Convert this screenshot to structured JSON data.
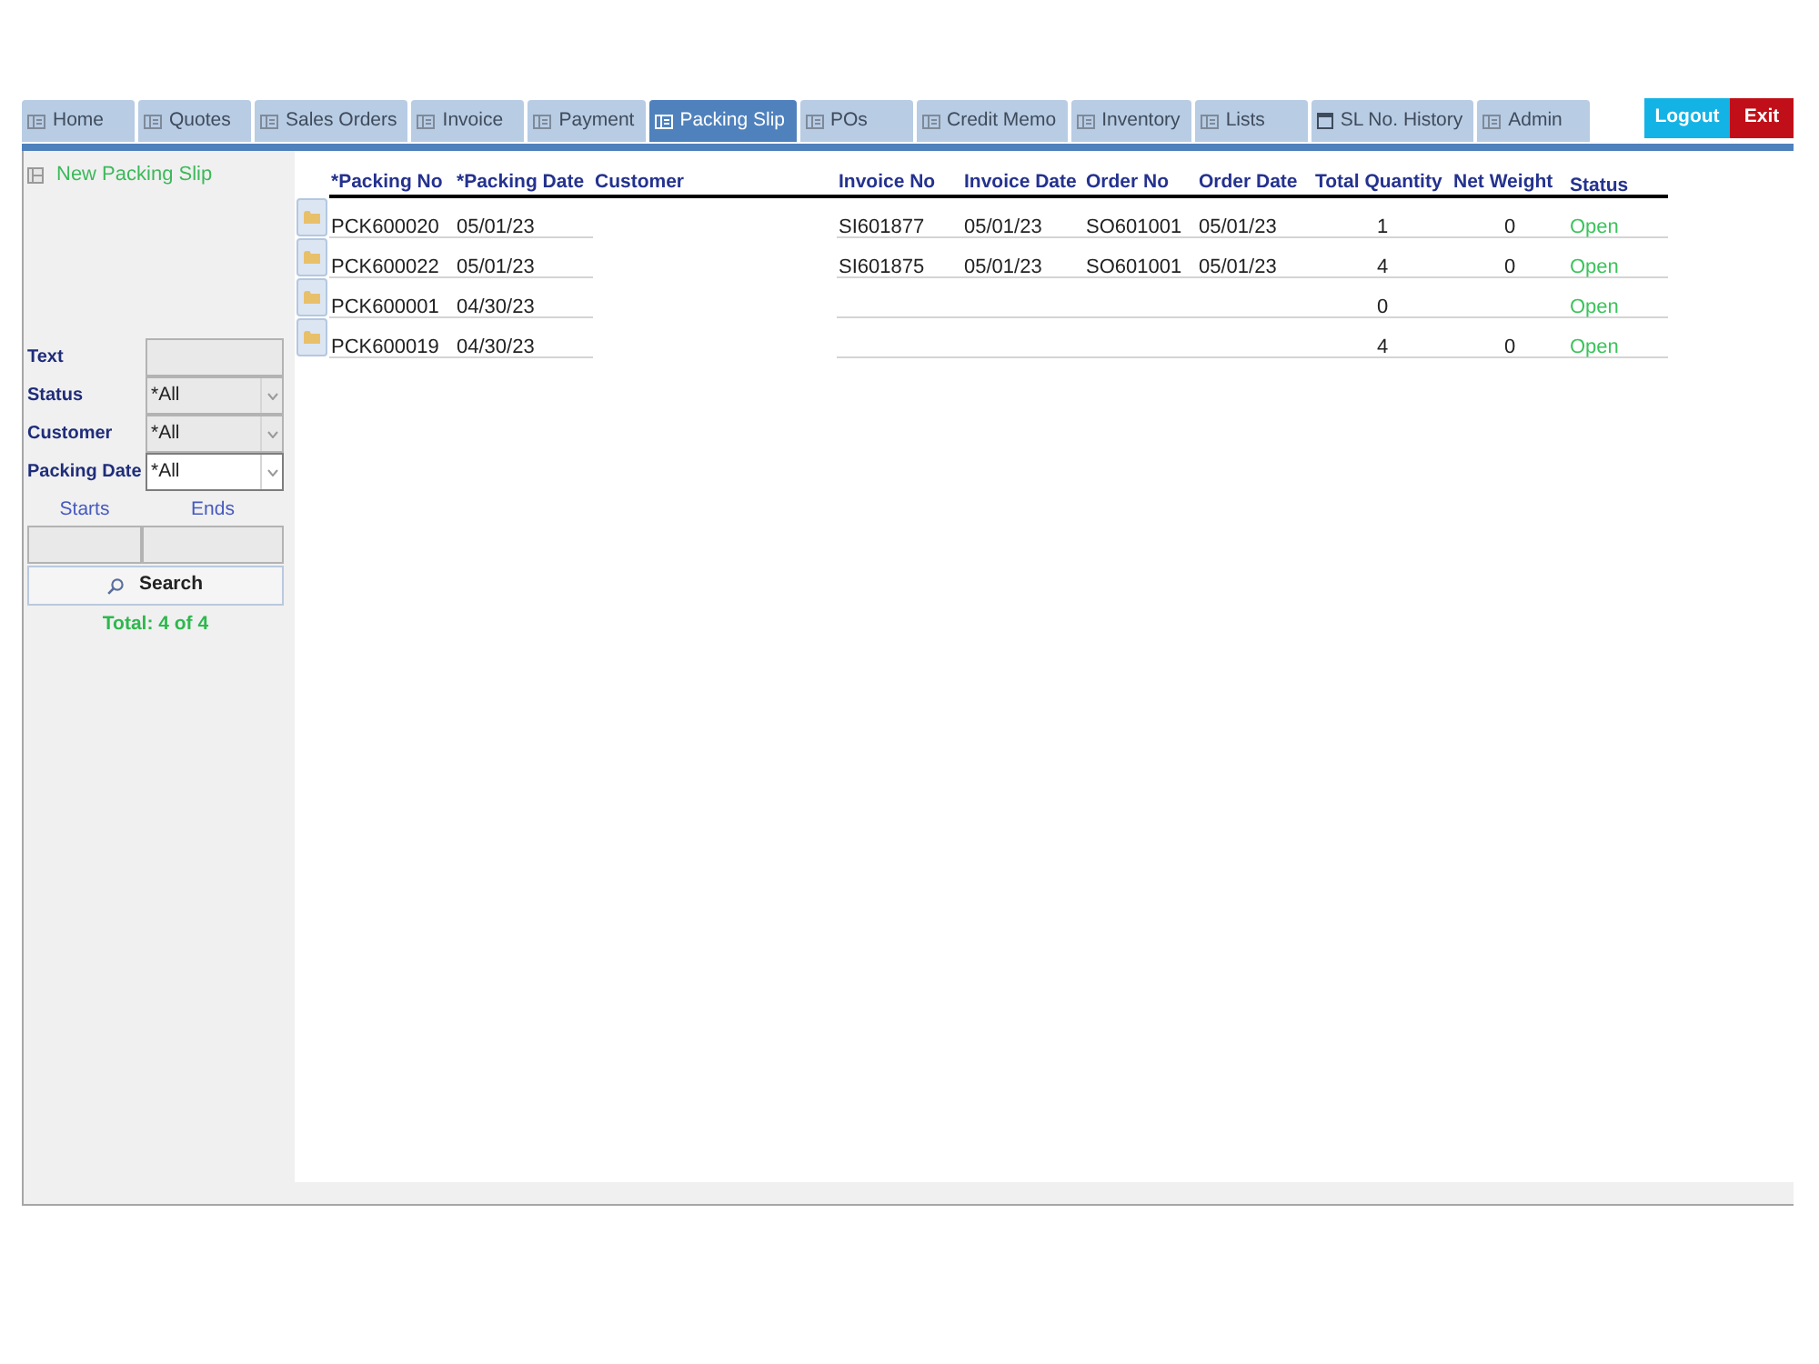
{
  "tabs": [
    {
      "label": "Home",
      "kind": "form",
      "selected": false
    },
    {
      "label": "Quotes",
      "kind": "form",
      "selected": false
    },
    {
      "label": "Sales Orders",
      "kind": "form",
      "selected": false
    },
    {
      "label": "Invoice",
      "kind": "form",
      "selected": false
    },
    {
      "label": "Payment",
      "kind": "form",
      "selected": false
    },
    {
      "label": "Packing Slip",
      "kind": "form",
      "selected": true
    },
    {
      "label": "POs",
      "kind": "form",
      "selected": false
    },
    {
      "label": "Credit Memo",
      "kind": "form",
      "selected": false
    },
    {
      "label": "Inventory",
      "kind": "form",
      "selected": false
    },
    {
      "label": "Lists",
      "kind": "form",
      "selected": false
    },
    {
      "label": "SL No. History",
      "kind": "window",
      "selected": false
    },
    {
      "label": "Admin",
      "kind": "form",
      "selected": false
    }
  ],
  "top_buttons": [
    {
      "label": "Logout",
      "kind": "logout"
    },
    {
      "label": "Exit",
      "kind": "exit"
    }
  ],
  "sidebar": {
    "new_button": "New Packing Slip",
    "filters": [
      {
        "label": "Text",
        "kind": "text",
        "focused": false
      },
      {
        "label": "Status",
        "kind": "dropdown",
        "value": "*All",
        "focused": false
      },
      {
        "label": "Customer",
        "kind": "dropdown",
        "value": "*All",
        "focused": false
      },
      {
        "label": "Packing Date",
        "kind": "dropdown",
        "value": "*All",
        "focused": true
      }
    ],
    "range_labels": [
      "Starts",
      "Ends"
    ],
    "search_button": "Search",
    "total": "Total: 4 of 4"
  },
  "table": {
    "columns": [
      {
        "label": "*Packing No",
        "kind": "text",
        "ruled": true
      },
      {
        "label": "*Packing Date",
        "kind": "text",
        "ruled": true
      },
      {
        "label": "Customer",
        "kind": "text",
        "ruled": false
      },
      {
        "label": "Invoice No",
        "kind": "text",
        "ruled": true
      },
      {
        "label": "Invoice Date",
        "kind": "text",
        "ruled": true
      },
      {
        "label": "Order No",
        "kind": "text",
        "ruled": true
      },
      {
        "label": "Order Date",
        "kind": "text",
        "ruled": true
      },
      {
        "label": "Total Quantity",
        "kind": "number",
        "ruled": true
      },
      {
        "label": "Net Weight",
        "kind": "number",
        "ruled": true
      },
      {
        "label": "Status",
        "kind": "status",
        "ruled": true
      }
    ],
    "rows": [
      {
        "cells": [
          "PCK600020",
          "05/01/23",
          null,
          "SI601877",
          "05/01/23",
          "SO601001",
          "05/01/23",
          "1",
          "0",
          "Open"
        ]
      },
      {
        "cells": [
          "PCK600022",
          "05/01/23",
          null,
          "SI601875",
          "05/01/23",
          "SO601001",
          "05/01/23",
          "4",
          "0",
          "Open"
        ]
      },
      {
        "cells": [
          "PCK600001",
          "04/30/23",
          null,
          null,
          null,
          null,
          null,
          "0",
          null,
          "Open"
        ]
      },
      {
        "cells": [
          "PCK600019",
          "04/30/23",
          null,
          null,
          null,
          null,
          null,
          "4",
          "0",
          "Open"
        ]
      }
    ]
  }
}
